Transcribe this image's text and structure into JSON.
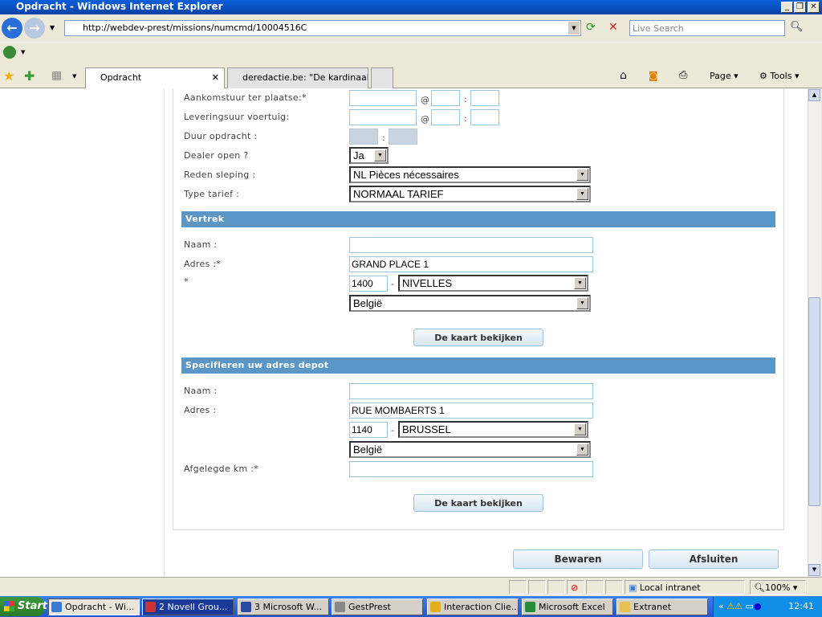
{
  "window": {
    "title": "Opdracht - Windows Internet Explorer"
  },
  "browser": {
    "url": "http://webdev-prest/missions/numcmd/10004516C",
    "search_placeholder": "Live Search",
    "tabs": [
      {
        "label": "Opdracht",
        "active": true
      },
      {
        "label": "deredactie.be: \"De kardinaal..."
      }
    ],
    "toolbar": {
      "page": "Page",
      "tools": "Tools"
    }
  },
  "form": {
    "fields": [
      {
        "label": "Aankomstuur ter plaatse:*"
      },
      {
        "label": "Leveringsuur voertuig:"
      },
      {
        "label": "Duur opdracht :"
      },
      {
        "label": "Dealer open ?",
        "value": "Ja"
      },
      {
        "label": "Reden sleping :",
        "value": "NL Pièces nécessaires"
      },
      {
        "label": "Type tarief :",
        "value": "NORMAAL TARIEF"
      }
    ],
    "at": "@",
    "colon": ":",
    "dash": "-",
    "vertrek": {
      "title": "Vertrek",
      "naam_label": "Naam :",
      "naam": "",
      "adres_label": "Adres :*",
      "adres": "GRAND PLACE 1",
      "postcode_label": "*",
      "postcode": "1400",
      "city": "NIVELLES",
      "country": "België",
      "map_button": "De kaart bekijken"
    },
    "depot": {
      "title": "Specifieren uw adres depot",
      "naam_label": "Naam :",
      "naam": "",
      "adres_label": "Adres :",
      "adres": "RUE MOMBAERTS 1",
      "postcode": "1140",
      "city": "BRUSSEL",
      "country": "België",
      "km_label": "Afgelegde km :*",
      "km": "",
      "map_button": "De kaart bekijken"
    },
    "save": "Bewaren",
    "close": "Afsluiten"
  },
  "statusbar": {
    "zone": "Local intranet",
    "zoom": "100%"
  },
  "taskbar": {
    "start": "Start",
    "items": [
      "Opdracht - Wi...",
      "2 Novell Grou...",
      "3 Microsoft W...",
      "GestPrest",
      "Interaction Clie...",
      "Microsoft Excel",
      "Extranet"
    ],
    "clock": "12:41"
  }
}
